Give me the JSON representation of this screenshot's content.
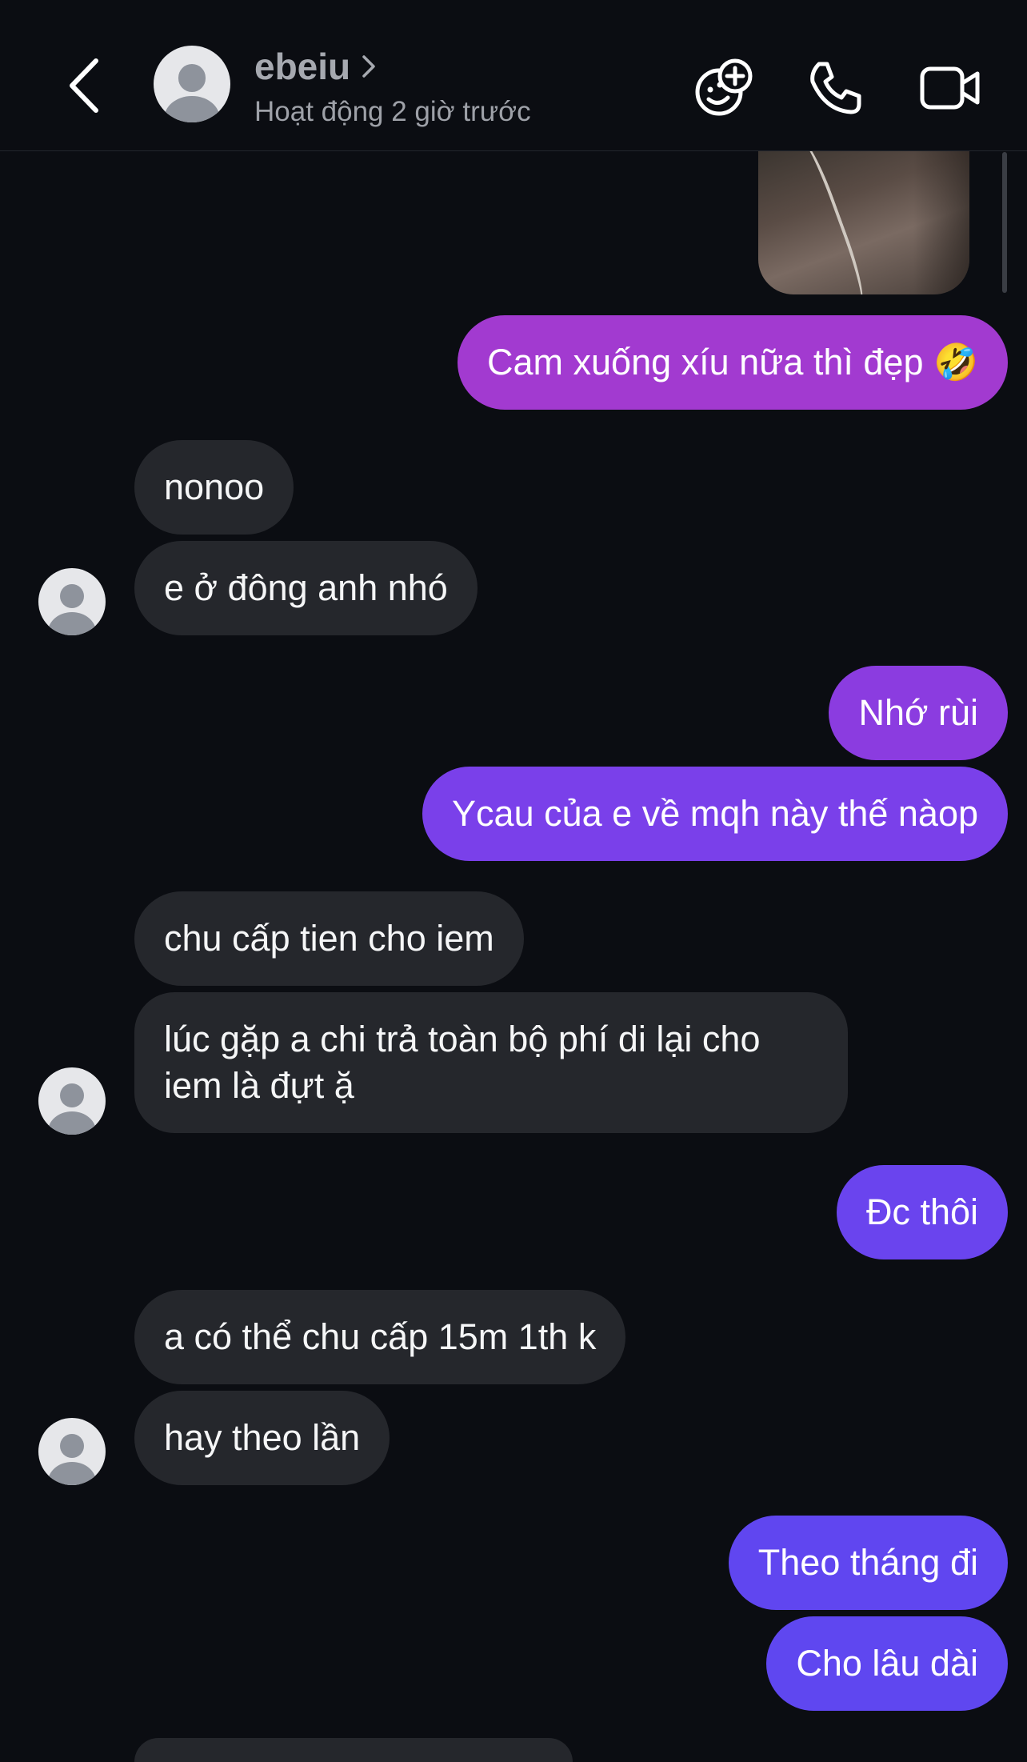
{
  "header": {
    "contact_name": "ebeiu",
    "status": "Hoạt động 2 giờ trước",
    "icons": [
      "back-arrow-icon",
      "avatar",
      "chevron-right-icon",
      "effects-add-icon",
      "phone-icon",
      "video-camera-icon"
    ]
  },
  "messages": [
    {
      "side": "out",
      "type": "image",
      "text": ""
    },
    {
      "side": "out",
      "text": "Cam xuống xíu nữa thì đẹp 🤣"
    },
    {
      "side": "in",
      "text": "nonoo"
    },
    {
      "side": "in",
      "text": "e ở đông anh nhó"
    },
    {
      "side": "out",
      "text": "Nhớ rùi"
    },
    {
      "side": "out",
      "text": "Ycau của e về mqh này thế nàop"
    },
    {
      "side": "in",
      "text": "chu cấp tien cho iem"
    },
    {
      "side": "in",
      "text": "lúc gặp a chi trả toàn bộ phí di lại cho iem là đựt ặ"
    },
    {
      "side": "out",
      "text": "Đc thôi"
    },
    {
      "side": "in",
      "text": "a có thể chu cấp 15m 1th k"
    },
    {
      "side": "in",
      "text": "hay theo lần"
    },
    {
      "side": "out",
      "text": "Theo tháng đi"
    },
    {
      "side": "out",
      "text": "Cho lâu dài"
    }
  ],
  "colors": {
    "background": "#0b0d12",
    "incoming_bubble": "#25272c",
    "outgoing_gradient": [
      "#a23ad0",
      "#8b3ce0",
      "#7a40ea",
      "#6a44ee",
      "#5f47f0"
    ]
  }
}
